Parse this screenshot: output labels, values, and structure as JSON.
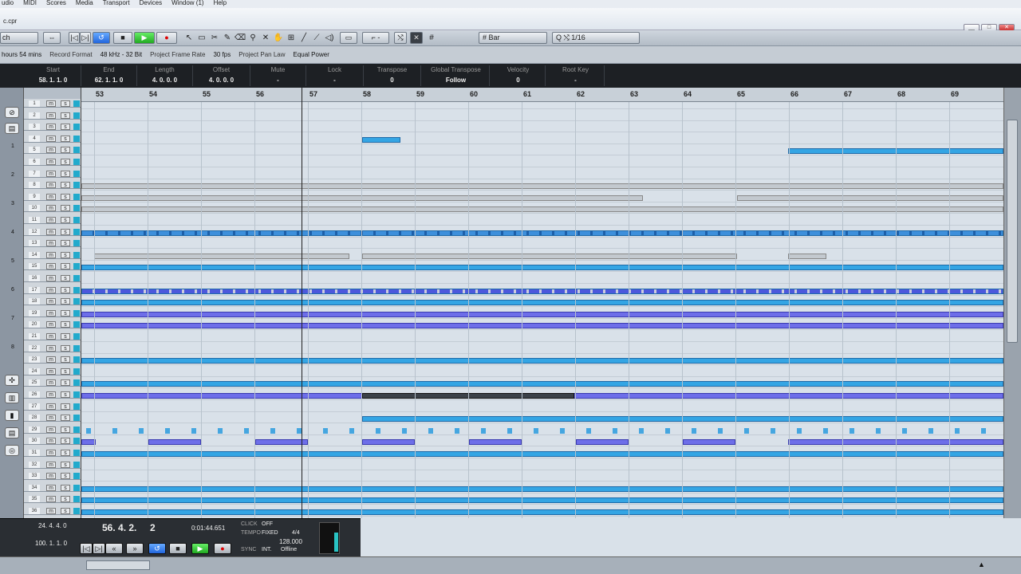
{
  "menu": [
    "udio",
    "MIDI",
    "Scores",
    "Media",
    "Transport",
    "Devices",
    "Window (1)",
    "Help"
  ],
  "window": {
    "title": "c.cpr",
    "min": "__",
    "max": "□",
    "close": "✕"
  },
  "toolbar": {
    "mode": "ch",
    "grid_type": "Bar",
    "quantize": "1/16",
    "quantize_prefix": "Q"
  },
  "status": {
    "record_time": "hours 54 mins",
    "record_format_label": "Record Format",
    "record_format": "48 kHz - 32 Bit",
    "frame_rate_label": "Project Frame Rate",
    "frame_rate": "30 fps",
    "pan_law_label": "Project Pan Law",
    "pan_law": "Equal Power"
  },
  "infoline": [
    {
      "label": "Start",
      "value": "58. 1. 1.  0"
    },
    {
      "label": "End",
      "value": "62. 1. 1.  0"
    },
    {
      "label": "Length",
      "value": "4. 0. 0.  0"
    },
    {
      "label": "Offset",
      "value": "4. 0. 0.  0"
    },
    {
      "label": "Mute",
      "value": "-"
    },
    {
      "label": "Lock",
      "value": "-"
    },
    {
      "label": "Transpose",
      "value": "0"
    },
    {
      "label": "Global Transpose",
      "value": "Follow"
    },
    {
      "label": "Velocity",
      "value": "0"
    },
    {
      "label": "Root Key",
      "value": "-"
    }
  ],
  "ruler_bars": [
    "53",
    "54",
    "55",
    "56",
    "57",
    "58",
    "59",
    "60",
    "61",
    "62",
    "63",
    "64",
    "65",
    "66",
    "67",
    "68",
    "69"
  ],
  "tracks": [
    "1",
    "2",
    "3",
    "4",
    "5",
    "6",
    "7",
    "8",
    "9",
    "10",
    "11",
    "12",
    "13",
    "14",
    "15",
    "16",
    "17",
    "18",
    "19",
    "20",
    "21",
    "22",
    "23",
    "24",
    "25",
    "26",
    "27",
    "28",
    "29",
    "30",
    "31",
    "32",
    "33",
    "34",
    "35",
    "36"
  ],
  "track_mute": "m",
  "track_solo": "s",
  "transport": {
    "left_locator": "24. 4. 4.   0",
    "right_locator": "100. 1. 1.   0",
    "position": "56. 4. 2.",
    "position_tick": "2",
    "time": "0:01:44.651",
    "click_label": "CLICK",
    "click": "OFF",
    "tempo_label": "TEMPO",
    "tempo_mode": "FIXED",
    "signature": "4/4",
    "tempo": "128.000",
    "sync_label": "SYNC",
    "sync": "INT.",
    "sync_status": "Offline"
  },
  "colors": {
    "event_blue": "#34a5e4",
    "event_purple": "#6d6ee9",
    "arrange_bg": "#d9e1e9"
  }
}
